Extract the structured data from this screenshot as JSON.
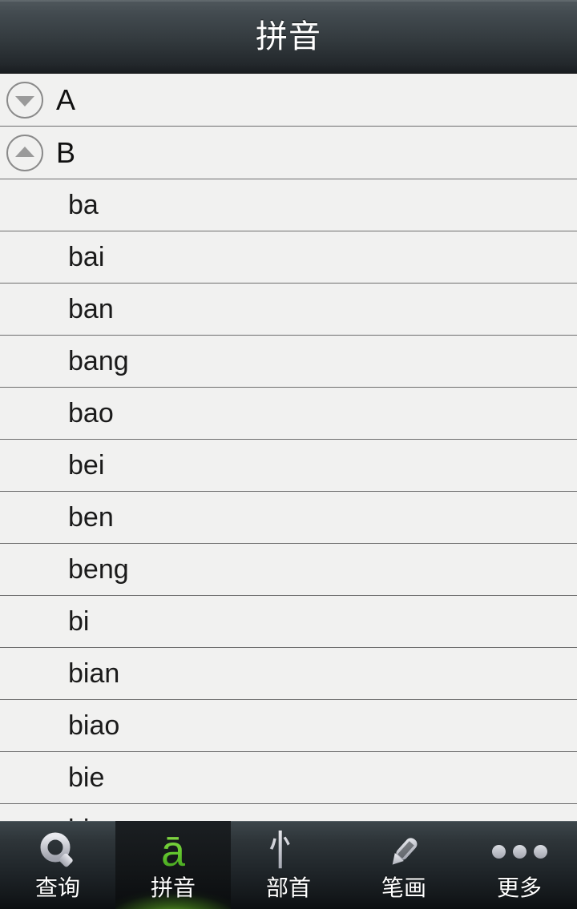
{
  "header": {
    "title": "拼音"
  },
  "list": {
    "sections": [
      {
        "letter": "A",
        "expanded": false,
        "toggle_icon": "chevron-down-icon"
      },
      {
        "letter": "B",
        "expanded": true,
        "toggle_icon": "chevron-up-icon"
      }
    ],
    "items": [
      "ba",
      "bai",
      "ban",
      "bang",
      "bao",
      "bei",
      "ben",
      "beng",
      "bi",
      "bian",
      "biao",
      "bie",
      "bin"
    ]
  },
  "tabbar": {
    "tabs": [
      {
        "label": "查询",
        "icon": "search-icon",
        "glyph": "Q",
        "active": false
      },
      {
        "label": "拼音",
        "icon": "pinyin-a-icon",
        "glyph": "ā",
        "active": true
      },
      {
        "label": "部首",
        "icon": "radical-icon",
        "glyph": "忄",
        "active": false
      },
      {
        "label": "笔画",
        "icon": "pencil-icon",
        "glyph": "",
        "active": false
      },
      {
        "label": "更多",
        "icon": "more-dots-icon",
        "glyph": "",
        "active": false
      }
    ]
  },
  "colors": {
    "accent_green": "#63c52e",
    "list_background": "#f1f1f0",
    "separator": "#6e6e6e",
    "titlebar_top": "#50585d",
    "titlebar_bottom": "#191d20"
  }
}
